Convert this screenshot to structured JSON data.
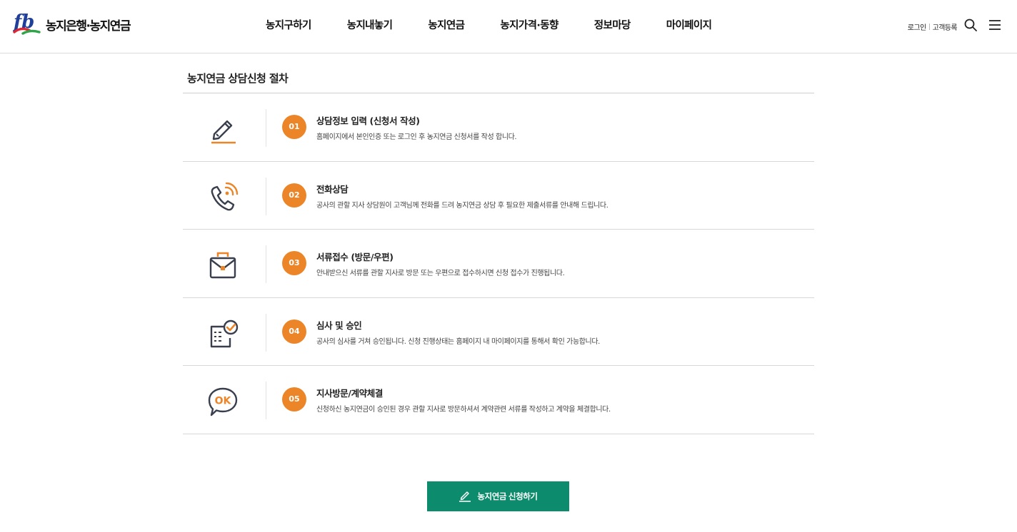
{
  "brand": {
    "logo_mark": "fb",
    "name": "농지은행·농지연금"
  },
  "nav": {
    "items": [
      {
        "label": "농지구하기"
      },
      {
        "label": "농지내놓기"
      },
      {
        "label": "농지연금"
      },
      {
        "label": "농지가격·동향"
      },
      {
        "label": "정보마당"
      },
      {
        "label": "마이페이지"
      }
    ]
  },
  "util": {
    "login": "로그인",
    "register": "고객등록",
    "search_icon": "search-icon",
    "menu_icon": "hamburger-menu-icon"
  },
  "section": {
    "title": "농지연금 상담신청 절차"
  },
  "steps": [
    {
      "num": "01",
      "icon": "pencil-icon",
      "title": "상담정보 입력 (신청서 작성)",
      "desc": "홈페이지에서 본인인증 또는 로그인 후 농지연금 신청서를 작성 합니다."
    },
    {
      "num": "02",
      "icon": "phone-call-icon",
      "title": "전화상담",
      "desc": "공사의 관할 지사 상담원이 고객님께 전화를 드려 농지연금 상담 후 필요한 제출서류를 안내해 드립니다."
    },
    {
      "num": "03",
      "icon": "briefcase-icon",
      "title": "서류접수 (방문/우편)",
      "desc": "안내받으신 서류를 관할 지사로 방문 또는 우편으로 접수하시면 신청 접수가 진행됩니다."
    },
    {
      "num": "04",
      "icon": "document-check-icon",
      "title": "심사 및 승인",
      "desc": "공사의 심사를 거쳐 승인됩니다. 신청 진행상태는 홈페이지 내 마이페이지를 통해서 확인 가능합니다."
    },
    {
      "num": "05",
      "icon": "ok-speech-bubble-icon",
      "title": "지사방문/계약체결",
      "desc": "신청하신 농지연금이 승인된 경우 관할 지사로 방문하셔서 계약관련 서류를 작성하고 계약을 체결합니다."
    }
  ],
  "cta": {
    "label": "농지연금 신청하기",
    "icon": "pencil-icon"
  },
  "colors": {
    "accent": "#ec8528",
    "primary_button": "#0c8c6c",
    "icon_dark": "#3a3f4d",
    "logo_blue": "#1f3f9a",
    "logo_red": "#e2262f",
    "logo_green": "#2fa44a"
  }
}
